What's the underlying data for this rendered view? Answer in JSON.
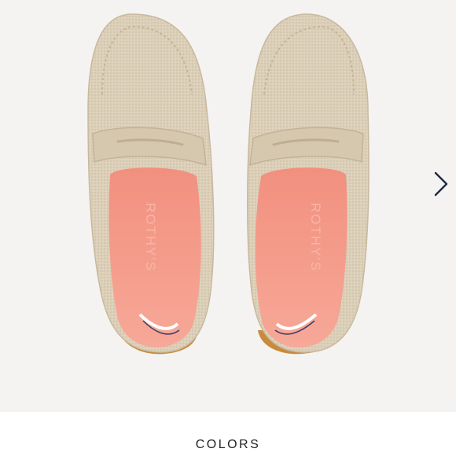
{
  "gallery": {
    "image_alt": "Beige knit driving loafers, top view",
    "brand_mark": "ROTHY'S",
    "next_icon": "chevron-right-icon",
    "colors": {
      "background": "#f4f3f1",
      "upper": "#dccfb8",
      "insole": "#f59c8c",
      "sole": "#c98a3c"
    }
  },
  "colors_section": {
    "title": "COLORS"
  }
}
